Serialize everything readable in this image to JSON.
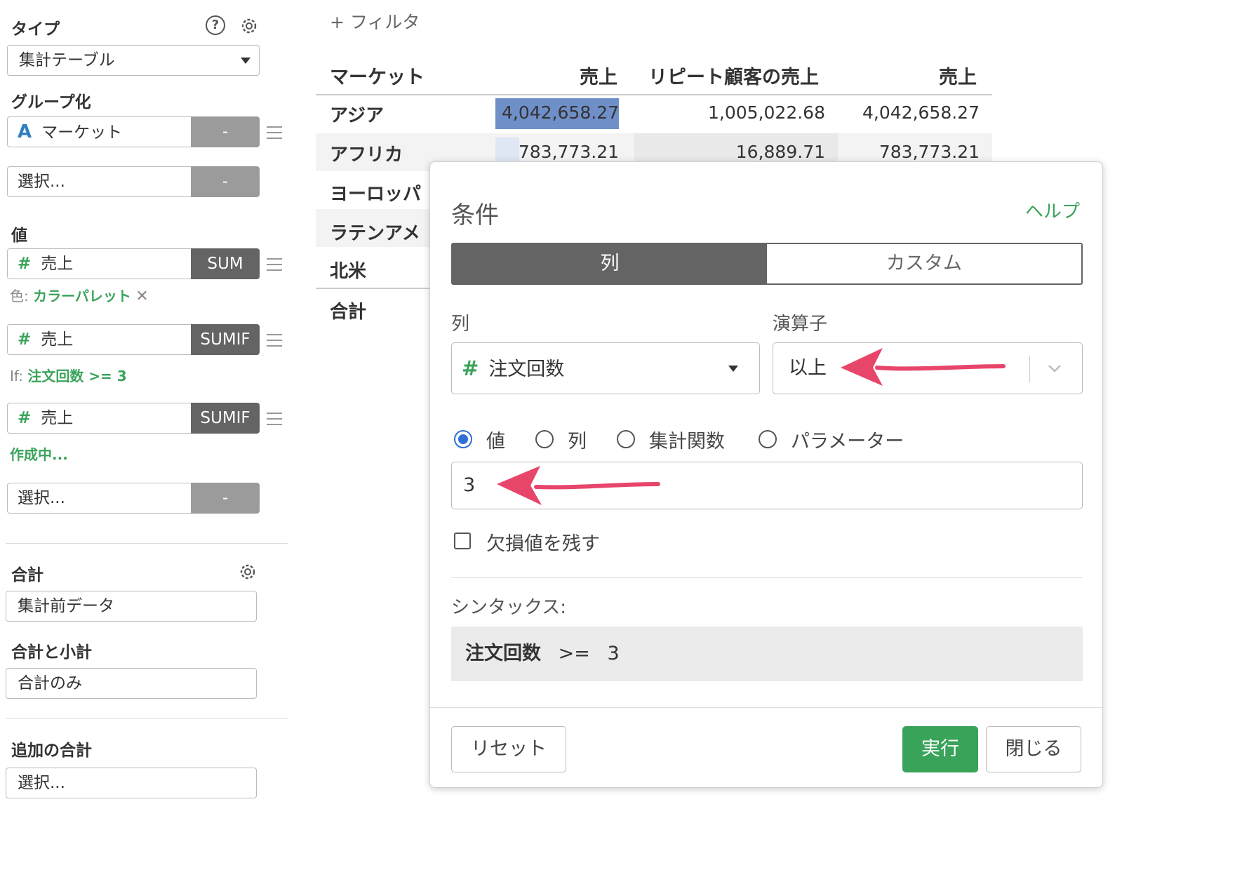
{
  "filter": {
    "add_label": "+ フィルタ"
  },
  "sidebar": {
    "type_label": "タイプ",
    "type_value": "集計テーブル",
    "group_label": "グループ化",
    "group_field": "マーケット",
    "group_field_btn": "-",
    "group_select": "選択...",
    "group_select_btn": "-",
    "value_label": "値",
    "values": [
      {
        "name": "売上",
        "agg": "SUM"
      },
      {
        "name": "売上",
        "agg": "SUMIF"
      },
      {
        "name": "売上",
        "agg": "SUMIF"
      }
    ],
    "color_prefix": "色:",
    "color_value": "カラーパレット",
    "if_prefix": "If:",
    "if_value": "注文回数 >= 3",
    "creating": "作成中...",
    "value_select": "選択...",
    "value_select_btn": "-",
    "total_label": "合計",
    "total_value": "集計前データ",
    "subtotal_label": "合計と小計",
    "subtotal_value": "合計のみ",
    "additional_label": "追加の合計",
    "additional_value": "選択..."
  },
  "table": {
    "headers": [
      "マーケット",
      "売上",
      "リピート顧客の売上",
      "売上"
    ],
    "rows": [
      {
        "label": "アジア",
        "values": [
          "4,042,658.27",
          "1,005,022.68",
          "4,042,658.27"
        ]
      },
      {
        "label": "アフリカ",
        "values": [
          "783,773.21",
          "16,889.71",
          "783,773.21"
        ]
      },
      {
        "label": "ヨーロッパ"
      },
      {
        "label": "ラテンアメ"
      },
      {
        "label": "北米"
      },
      {
        "label": "合計"
      }
    ]
  },
  "dialog": {
    "title": "条件",
    "help": "ヘルプ",
    "tabs": [
      "列",
      "カスタム"
    ],
    "column_label": "列",
    "column_value": "注文回数",
    "operator_label": "演算子",
    "operator_value": "以上",
    "radio_options": [
      "値",
      "列",
      "集計関数",
      "パラメーター"
    ],
    "value_input": "3",
    "keep_missing": "欠損値を残す",
    "syntax_label": "シンタックス:",
    "syntax_field": "注文回数",
    "syntax_op": ">=",
    "syntax_value": "3",
    "reset": "リセット",
    "run": "実行",
    "close": "閉じる"
  },
  "colors": {
    "accent_green": "#3aa35a",
    "arrow_pink": "#e8456b",
    "highlight_blue": "#6f8fc9",
    "tab_active": "#646464"
  }
}
